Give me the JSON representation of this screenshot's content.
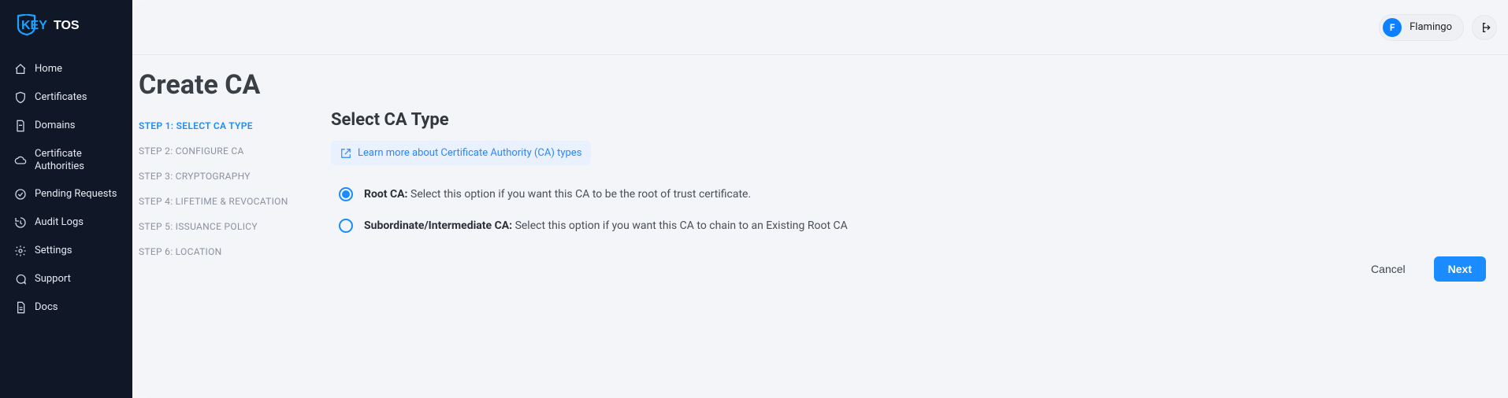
{
  "brand": {
    "name": "KEYTOS",
    "accent": "#1aa3ff"
  },
  "sidebar": {
    "items": [
      {
        "label": "Home",
        "icon": "home-icon"
      },
      {
        "label": "Certificates",
        "icon": "shield-icon"
      },
      {
        "label": "Domains",
        "icon": "file-icon"
      },
      {
        "label": "Certificate Authorities",
        "icon": "cloud-icon"
      },
      {
        "label": "Pending Requests",
        "icon": "check-circle-icon"
      },
      {
        "label": "Audit Logs",
        "icon": "history-icon"
      },
      {
        "label": "Settings",
        "icon": "gear-icon"
      },
      {
        "label": "Support",
        "icon": "chat-icon"
      },
      {
        "label": "Docs",
        "icon": "doc-icon"
      }
    ]
  },
  "user": {
    "initial": "F",
    "name": "Flamingo"
  },
  "page": {
    "title": "Create CA"
  },
  "wizard": {
    "steps": [
      {
        "label": "STEP 1: SELECT CA TYPE",
        "active": true
      },
      {
        "label": "STEP 2: CONFIGURE CA",
        "active": false
      },
      {
        "label": "STEP 3: CRYPTOGRAPHY",
        "active": false
      },
      {
        "label": "STEP 4: LIFETIME & REVOCATION",
        "active": false
      },
      {
        "label": "STEP 5: ISSUANCE POLICY",
        "active": false
      },
      {
        "label": "STEP 6: LOCATION",
        "active": false
      }
    ]
  },
  "section": {
    "title": "Select CA Type",
    "learn_more": "Learn more about Certificate Authority (CA) types"
  },
  "options": {
    "root": {
      "title": "Root CA:",
      "desc": "Select this option if you want this CA to be the root of trust certificate.",
      "selected": true
    },
    "sub": {
      "title": "Subordinate/Intermediate CA:",
      "desc": "Select this option if you want this CA to chain to an Existing Root CA",
      "selected": false
    }
  },
  "buttons": {
    "cancel": "Cancel",
    "next": "Next"
  }
}
